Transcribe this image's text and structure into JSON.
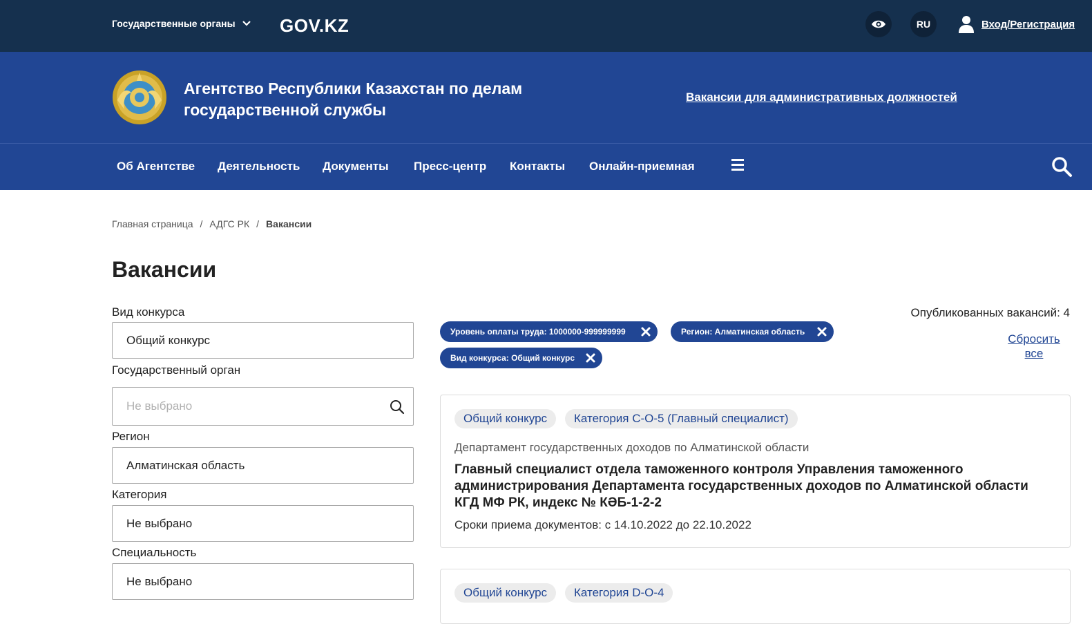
{
  "topbar": {
    "gov_organs_label": "Государственные органы",
    "logo_text": "GOV.KZ",
    "lang": "RU",
    "login_label": "Вход/Регистрация"
  },
  "header": {
    "agency_title": "Агентство Республики Казахстан по делам государственной службы",
    "admin_vacancies_link": "Вакансии для административных должностей"
  },
  "nav": {
    "items": [
      "Об Агентстве",
      "Деятельность",
      "Документы",
      "Пресс-центр",
      "Контакты",
      "Онлайн-приемная"
    ]
  },
  "breadcrumb": {
    "items": [
      "Главная страница",
      "АДГС РК",
      "Вакансии"
    ]
  },
  "page": {
    "title": "Вакансии"
  },
  "filters": {
    "competition_type": {
      "label": "Вид конкурса",
      "value": "Общий конкурс"
    },
    "gov_body": {
      "label": "Государственный орган",
      "placeholder": "Не выбрано"
    },
    "region": {
      "label": "Регион",
      "value": "Алматинская область"
    },
    "category": {
      "label": "Категория",
      "value": "Не выбрано"
    },
    "specialty": {
      "label": "Специальность",
      "value": "Не выбрано"
    }
  },
  "active_filters": {
    "chips": [
      "Уровень оплаты труда: 1000000-999999999",
      "Регион: Алматинская область",
      "Вид конкурса: Общий конкурс"
    ],
    "published_count": "Опубликованных вакансий: 4",
    "reset_label": "Сбросить все"
  },
  "vacancies": [
    {
      "tags": [
        "Общий конкурс",
        "Категория C-O-5 (Главный специалист)"
      ],
      "department": "Департамент государственных доходов по Алматинской области",
      "title": "Главный специалист отдела таможенного контроля Управления таможенного администрирования Департамента государственных доходов по Алматинской области КГД МФ РК, индекс № КӘБ-1-2-2",
      "dates": "Сроки приема документов: с 14.10.2022 до 22.10.2022"
    },
    {
      "tags": [
        "Общий конкурс",
        "Категория D-O-4"
      ]
    }
  ]
}
